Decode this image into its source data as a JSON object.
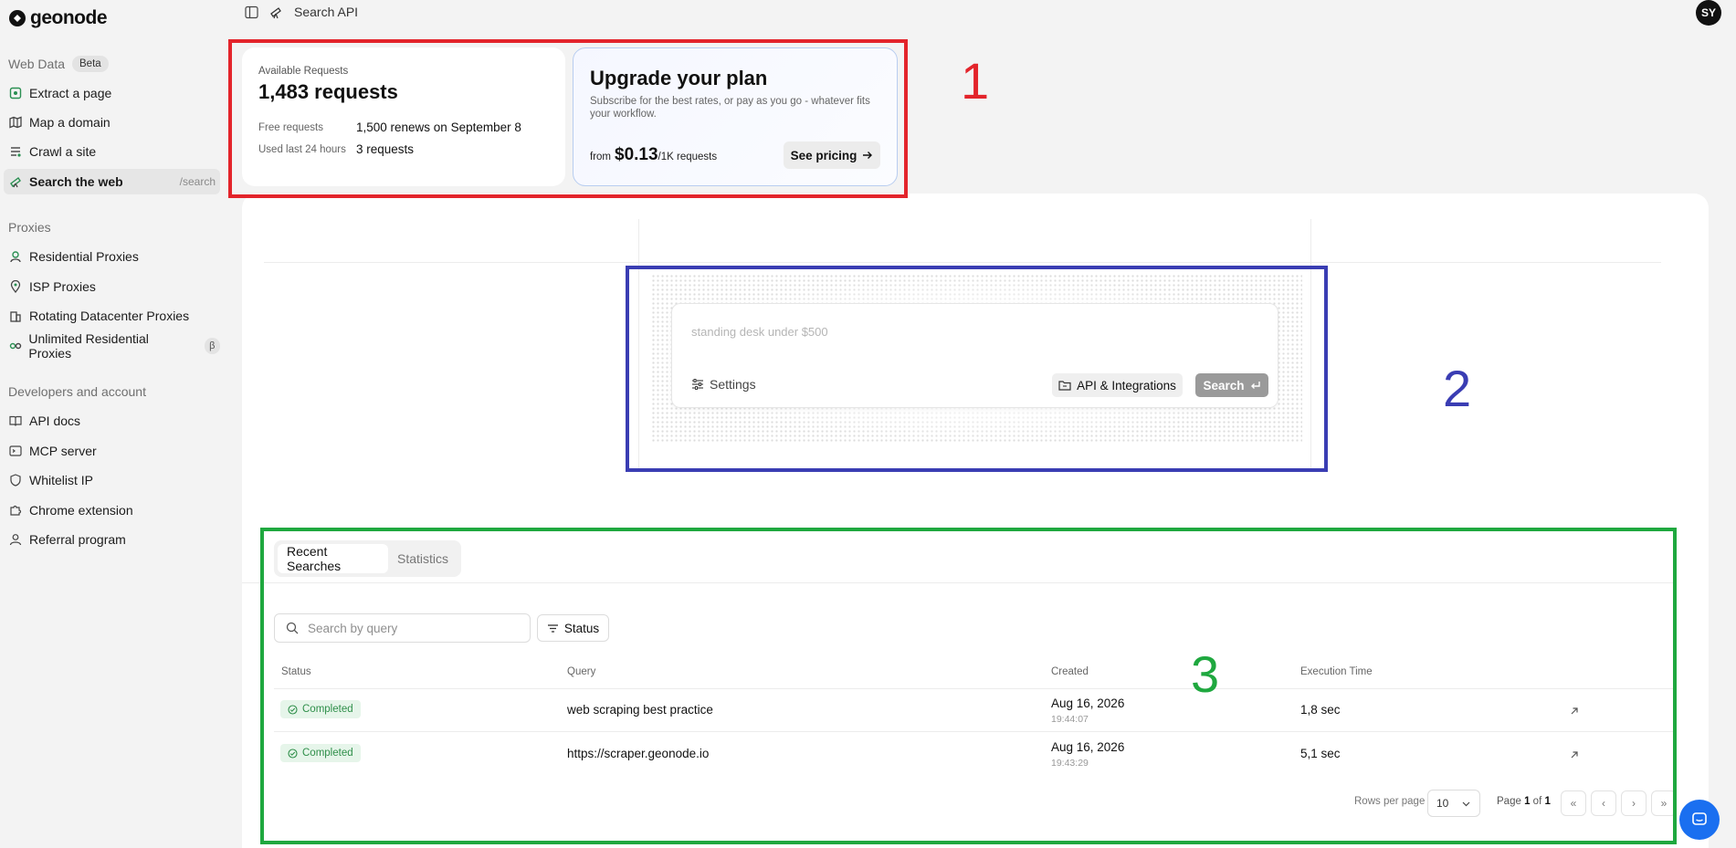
{
  "app": {
    "logo_text": "geonode"
  },
  "topbar": {
    "title": "Search API",
    "avatar_initials": "SY"
  },
  "sidebar": {
    "sections": [
      {
        "label": "Web Data",
        "badge": "Beta"
      },
      {
        "label": "Proxies"
      },
      {
        "label": "Developers and account"
      }
    ],
    "web_data_items": [
      {
        "label": "Extract a page",
        "icon": "extract-icon"
      },
      {
        "label": "Map a domain",
        "icon": "map-icon"
      },
      {
        "label": "Crawl a site",
        "icon": "crawl-icon"
      },
      {
        "label": "Search the web",
        "icon": "telescope-icon",
        "shortcut": "/search",
        "active": true
      }
    ],
    "proxy_items": [
      {
        "label": "Residential Proxies",
        "icon": "residential-icon"
      },
      {
        "label": "ISP Proxies",
        "icon": "pin-icon"
      },
      {
        "label": "Rotating Datacenter Proxies",
        "icon": "building-icon"
      },
      {
        "label": "Unlimited Residential Proxies",
        "icon": "infinity-icon",
        "badge": "β"
      }
    ],
    "dev_items": [
      {
        "label": "API docs",
        "icon": "book-icon"
      },
      {
        "label": "MCP server",
        "icon": "terminal-icon"
      },
      {
        "label": "Whitelist IP",
        "icon": "shield-icon"
      },
      {
        "label": "Chrome extension",
        "icon": "puzzle-icon"
      },
      {
        "label": "Referral program",
        "icon": "user-icon"
      }
    ]
  },
  "annotations": {
    "one": "1",
    "two": "2",
    "three": "3"
  },
  "requests_card": {
    "label": "Available Requests",
    "value": "1,483 requests",
    "free_label": "Free requests",
    "free_value": "1,500 renews on September 8",
    "used_label": "Used last 24 hours",
    "used_value": "3 requests"
  },
  "upgrade_card": {
    "title": "Upgrade your plan",
    "subtitle": "Subscribe for the best rates, or pay as you go - whatever fits your workflow.",
    "price_prefix": "from",
    "price": "$0.13",
    "price_unit": "/1K requests",
    "cta": "See pricing"
  },
  "search_panel": {
    "placeholder": "standing desk under $500",
    "settings_label": "Settings",
    "api_label": "API & Integrations",
    "search_label": "Search"
  },
  "history": {
    "tabs": [
      {
        "label": "Recent Searches",
        "active": true
      },
      {
        "label": "Statistics",
        "active": false
      }
    ],
    "search_placeholder": "Search by query",
    "status_filter_label": "Status",
    "columns": {
      "status": "Status",
      "query": "Query",
      "created": "Created",
      "execution_time": "Execution Time"
    },
    "rows": [
      {
        "status": "Completed",
        "query": "web scraping best practice",
        "date": "Aug 16, 2026",
        "time": "19:44:07",
        "exec": "1,8 sec"
      },
      {
        "status": "Completed",
        "query": "https://scraper.geonode.io",
        "date": "Aug 16, 2026",
        "time": "19:43:29",
        "exec": "5,1 sec"
      }
    ],
    "pagination": {
      "rows_per_page_label": "Rows per page",
      "rows_per_page": "10",
      "page_prefix": "Page",
      "page_current": "1",
      "page_of": "of",
      "page_total": "1",
      "first": "«",
      "prev": "‹",
      "next": "›",
      "last": "»"
    }
  },
  "colors": {
    "annotation_red": "#e3242b",
    "annotation_blue": "#3a3db3",
    "annotation_green": "#1fa83f",
    "chat": "#1a6ff0"
  }
}
